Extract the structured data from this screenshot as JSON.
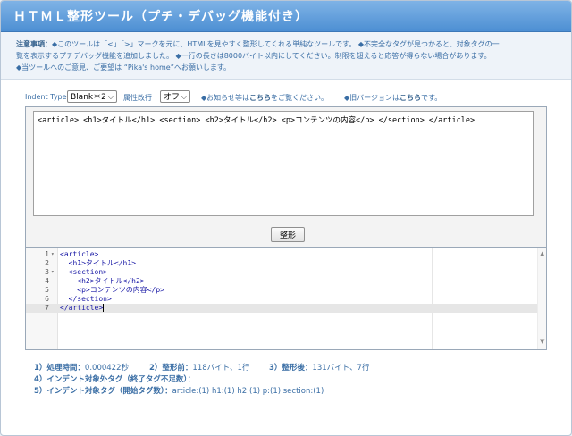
{
  "app": {
    "title": "ＨＴＭＬ整形ツール（プチ・デバッグ機能付き）"
  },
  "notice": {
    "lead": "注意事項：",
    "line1": "◆このツールは「<」「>」マークを元に、HTMLを見やすく整形してくれる単純なツールです。 ◆不完全なタグが見つかると、対象タグの一",
    "line2": "覧を表示するプチデバッグ機能を追加しました。 ◆一行の長さは8000バイト以内にしてください。制限を超えると応答が得らない場合があります。",
    "line3": "◆当ツールへのご意見、ご要望は “Pika's home”へお願いします。"
  },
  "options": {
    "indent_label": "Indent Type",
    "indent_value": "Blank＊2",
    "attr_label": "属性改行",
    "attr_value": "オフ",
    "news_pre": "◆お知らせ等は",
    "news_link": "こちら",
    "news_post": "をご覧ください。",
    "old_pre": "◆旧バージョンは",
    "old_link": "こちら",
    "old_post": "です。"
  },
  "input": {
    "value": "<article> <h1>タイトル</h1> <section> <h2>タイトル</h2> <p>コンテンツの内容</p> </section> </article>"
  },
  "format_button": "整形",
  "output": {
    "lines": [
      {
        "num": "1",
        "fold": "▾",
        "code": "<article>"
      },
      {
        "num": "2",
        "fold": "",
        "code": "  <h1>タイトル</h1>"
      },
      {
        "num": "3",
        "fold": "▾",
        "code": "  <section>"
      },
      {
        "num": "4",
        "fold": "",
        "code": "    <h2>タイトル</h2>"
      },
      {
        "num": "5",
        "fold": "",
        "code": "    <p>コンテンツの内容</p>"
      },
      {
        "num": "6",
        "fold": "",
        "code": "  </section>"
      },
      {
        "num": "7",
        "fold": "",
        "code": "</article>"
      }
    ],
    "scroll_up": "▲",
    "scroll_down": "▼"
  },
  "stats": {
    "s1_label": "1）処理時間：",
    "s1_value": "0.000422秒",
    "s2_label": "2）整形前：",
    "s2_value": "118バイト、1行",
    "s3_label": "3）整形後：",
    "s3_value": "131バイト、7行",
    "s4_label": "4）インデント対象外タグ（終了タグ不足数）：",
    "s4_value": "",
    "s5_label": "5）インデント対象タグ（開始タグ数）：",
    "s5_value": "article:(1) h1:(1) h2:(1) p:(1) section:(1)"
  }
}
